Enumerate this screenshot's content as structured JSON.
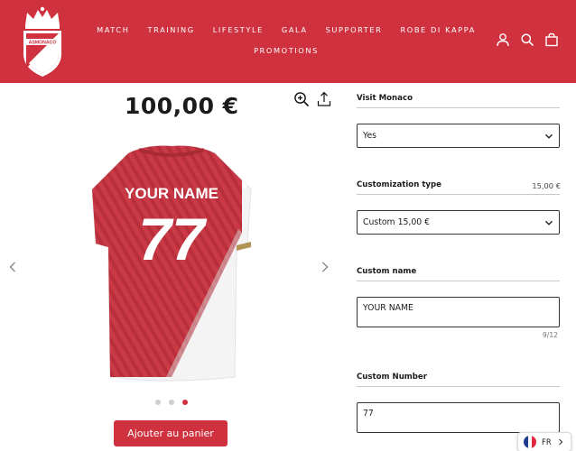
{
  "colors": {
    "brand_red": "#cf313f",
    "accent_gold": "#b39256"
  },
  "header": {
    "logo_text": "ASMONACO",
    "nav_row1": [
      "MATCH",
      "TRAINING",
      "LIFESTYLE",
      "GALA",
      "SUPPORTER",
      "ROBE DI KAPPA"
    ],
    "nav_row2": [
      "PROMOTIONS"
    ],
    "icons": [
      "user-icon",
      "search-icon",
      "cart-icon"
    ]
  },
  "product": {
    "price": "100,00 €",
    "jersey_name": "YOUR NAME",
    "jersey_number": "77",
    "add_to_cart": "Ajouter au panier",
    "gallery_dots": 3,
    "gallery_active_index": 2
  },
  "options": {
    "visit": {
      "label": "Visit Monaco",
      "value": "Yes"
    },
    "customization": {
      "label": "Customization type",
      "extra": "15,00 €",
      "value": "Custom 15,00 €"
    },
    "custom_name": {
      "label": "Custom name",
      "value": "YOUR NAME",
      "counter": "9/12"
    },
    "custom_number": {
      "label": "Custom Number",
      "value": "77"
    }
  },
  "language": {
    "code": "FR",
    "flag_colors": [
      "#1e3d8f",
      "#ffffff",
      "#e1283c"
    ]
  }
}
